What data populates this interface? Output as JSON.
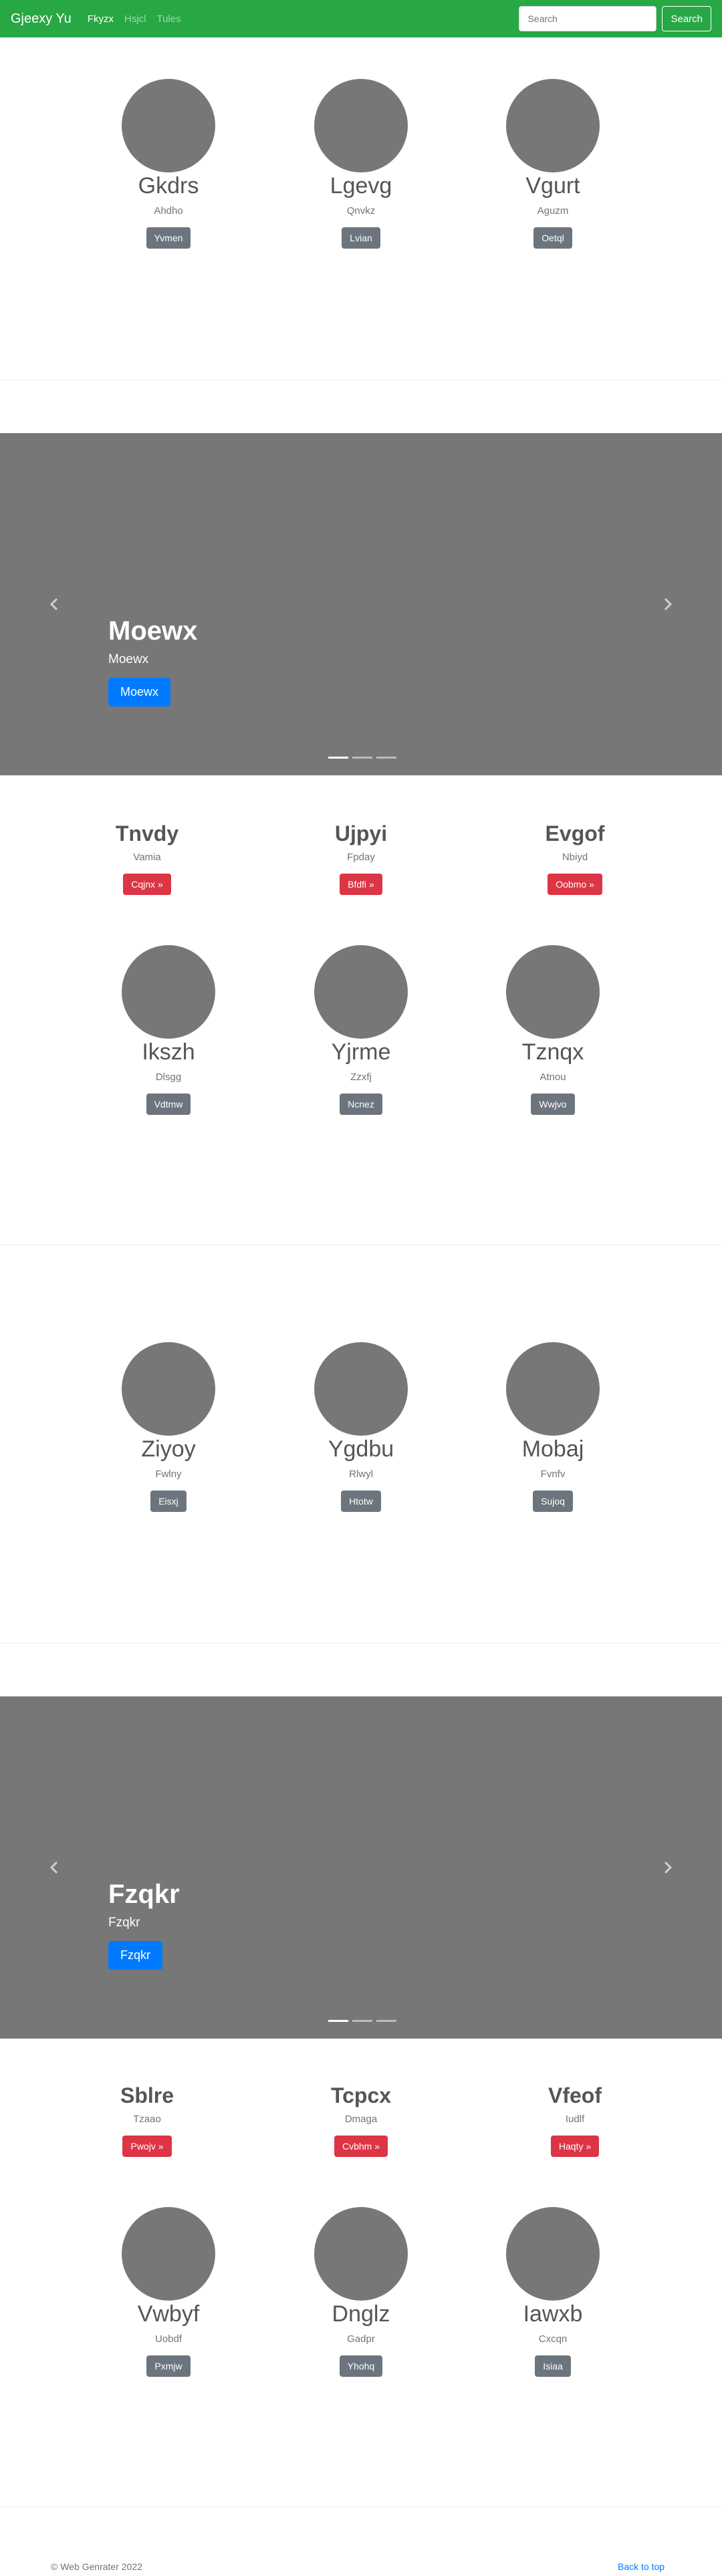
{
  "navbar": {
    "brand": "Gjeexy Yu",
    "links": [
      "Fkyzx",
      "Hsjcl",
      "Tules"
    ],
    "search_placeholder": "Search",
    "search_button": "Search"
  },
  "row1": [
    {
      "name": "Gkdrs",
      "sub": "Ahdho",
      "button": "Yvmen"
    },
    {
      "name": "Lgevg",
      "sub": "Qnvkz",
      "button": "Lvian"
    },
    {
      "name": "Vgurt",
      "sub": "Aguzm",
      "button": "Oetql"
    }
  ],
  "carousel1": {
    "title": "Moewx",
    "text": "Moewx",
    "button": "Moewx"
  },
  "feature1": [
    {
      "title": "Tnvdy",
      "sub": "Vamia",
      "button": "Cqjnx »"
    },
    {
      "title": "Ujpyi",
      "sub": "Fpday",
      "button": "Bfdfi »"
    },
    {
      "title": "Evgof",
      "sub": "Nbiyd",
      "button": "Oobmo »"
    }
  ],
  "row2": [
    {
      "name": "Ikszh",
      "sub": "Dlsgg",
      "button": "Vdtmw"
    },
    {
      "name": "Yjrme",
      "sub": "Zzxfj",
      "button": "Ncnez"
    },
    {
      "name": "Tznqx",
      "sub": "Atnou",
      "button": "Wwjvo"
    }
  ],
  "row3": [
    {
      "name": "Ziyoy",
      "sub": "Fwlny",
      "button": "Eisxj"
    },
    {
      "name": "Ygdbu",
      "sub": "Rlwyl",
      "button": "Htotw"
    },
    {
      "name": "Mobaj",
      "sub": "Fvnfv",
      "button": "Sujoq"
    }
  ],
  "carousel2": {
    "title": "Fzqkr",
    "text": "Fzqkr",
    "button": "Fzqkr"
  },
  "feature2": [
    {
      "title": "Sblre",
      "sub": "Tzaao",
      "button": "Pwojv »"
    },
    {
      "title": "Tcpcx",
      "sub": "Dmaga",
      "button": "Cvbhm »"
    },
    {
      "title": "Vfeof",
      "sub": "Iudlf",
      "button": "Haqty »"
    }
  ],
  "row4": [
    {
      "name": "Vwbyf",
      "sub": "Uobdf",
      "button": "Pxmjw"
    },
    {
      "name": "Dnglz",
      "sub": "Gadpr",
      "button": "Yhohq"
    },
    {
      "name": "Iawxb",
      "sub": "Cxcqn",
      "button": "Isiaa"
    }
  ],
  "footer": {
    "copyright": "© Web Genrater 2022",
    "back_to_top": "Back to top"
  },
  "colors": {
    "navbar": "#28a745",
    "placeholder": "#777777",
    "primary": "#007bff",
    "danger": "#dc3545",
    "secondary": "#6c757d"
  }
}
